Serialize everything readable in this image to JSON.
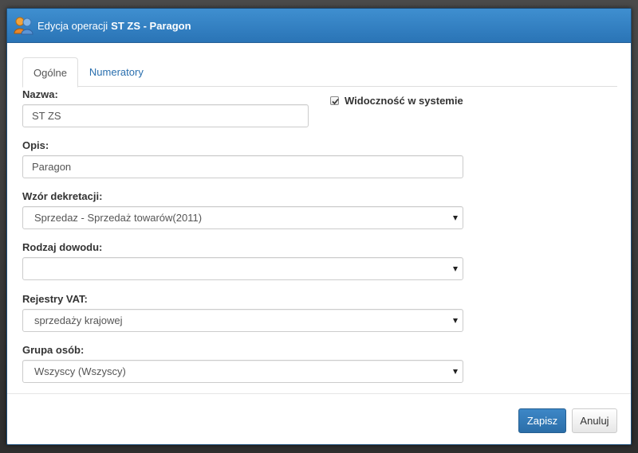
{
  "dialog": {
    "title_prefix": "Edycja operacji",
    "title_main": "ST ZS - Paragon"
  },
  "tabs": [
    {
      "label": "Ogólne",
      "active": true
    },
    {
      "label": "Numeratory",
      "active": false
    }
  ],
  "form": {
    "name": {
      "label": "Nazwa:",
      "value": "ST ZS"
    },
    "visibility": {
      "label": "Widoczność w systemie",
      "checked": true
    },
    "description": {
      "label": "Opis:",
      "value": "Paragon"
    },
    "posting_template": {
      "label": "Wzór dekretacji:",
      "value": "Sprzedaz - Sprzedaż towarów(2011)"
    },
    "document_type": {
      "label": "Rodzaj dowodu:",
      "value": ""
    },
    "vat_registers": {
      "label": "Rejestry VAT:",
      "value": "sprzedaży krajowej"
    },
    "person_group": {
      "label": "Grupa osób:",
      "value": "Wszyscy (Wszyscy)"
    }
  },
  "buttons": {
    "save": "Zapisz",
    "cancel": "Anuluj"
  },
  "icons": {
    "app": "users-icon",
    "caret": "caret-down-icon",
    "check": "check-icon"
  },
  "colors": {
    "titlebar": "#2f7dc0",
    "primary_button": "#337ab7",
    "link": "#2a6fae"
  }
}
